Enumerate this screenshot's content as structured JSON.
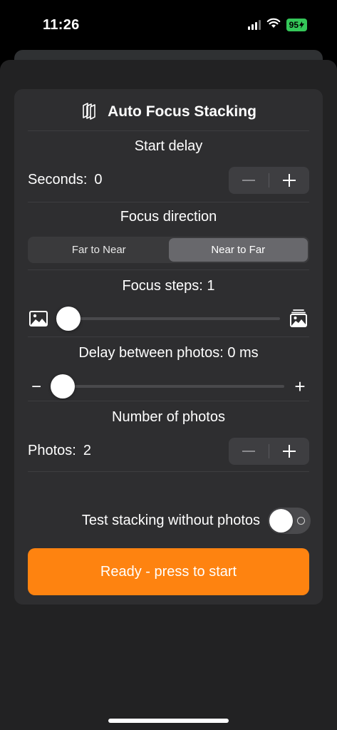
{
  "status_bar": {
    "time": "11:26",
    "battery": "95",
    "icons": [
      "signal-icon",
      "wifi-icon",
      "battery-icon"
    ]
  },
  "panel": {
    "title": "Auto Focus Stacking",
    "title_icon": "stack-icon",
    "start_delay": {
      "title": "Start delay",
      "label": "Seconds:",
      "value": "0"
    },
    "focus_direction": {
      "title": "Focus direction",
      "options": [
        "Far to Near",
        "Near to Far"
      ],
      "selected": "Near to Far"
    },
    "focus_steps": {
      "title": "Focus steps: 1",
      "value": 1,
      "slider_fraction": 0.0,
      "left_icon": "photo-icon",
      "right_icon": "photo-stack-icon"
    },
    "delay_between": {
      "title": "Delay between photos: 0 ms",
      "value_ms": 0,
      "slider_fraction": 0.0,
      "minus_symbol": "−",
      "plus_symbol": "+"
    },
    "number_of_photos": {
      "title": "Number of photos",
      "label": "Photos:",
      "value": "2"
    },
    "test_stacking": {
      "label": "Test stacking without photos",
      "enabled": false
    },
    "start_button": "Ready - press to start"
  },
  "colors": {
    "accent": "#fe8310",
    "panel": "#2e2e30",
    "sheet": "#222223",
    "battery": "#34c759"
  }
}
